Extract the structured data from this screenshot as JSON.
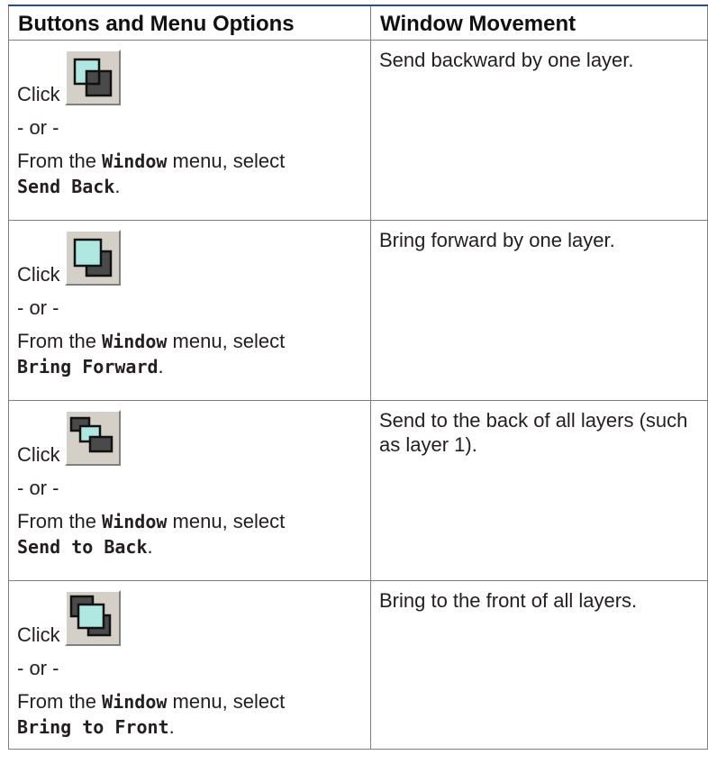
{
  "table": {
    "headers": [
      "Buttons and Menu Options",
      "Window Movement"
    ],
    "rows": [
      {
        "click_label": "Click",
        "icon": "send-back-icon",
        "or_label": "- or -",
        "menu_prefix": "From the",
        "menu_name": "Window",
        "menu_middle": "menu, select",
        "command": "Send Back",
        "period": ".",
        "description": "Send backward by one layer."
      },
      {
        "click_label": "Click",
        "icon": "bring-forward-icon",
        "or_label": "- or -",
        "menu_prefix": "From the",
        "menu_name": "Window",
        "menu_middle": "menu, select",
        "command": "Bring Forward",
        "period": ".",
        "description": "Bring forward by one layer."
      },
      {
        "click_label": "Click",
        "icon": "send-to-back-icon",
        "or_label": "- or -",
        "menu_prefix": "From the",
        "menu_name": "Window",
        "menu_middle": "menu, select",
        "command": "Send to Back",
        "period": ".",
        "description": "Send to the back of all layers (such as layer 1)."
      },
      {
        "click_label": "Click",
        "icon": "bring-to-front-icon",
        "or_label": "- or -",
        "menu_prefix": "From the",
        "menu_name": "Window",
        "menu_middle": "menu, select",
        "command": "Bring to Front",
        "period": ".",
        "description": "Bring to the front of all layers."
      }
    ]
  },
  "colors": {
    "header_rule": "#2a4e8a",
    "icon_front_fill": "#aee8e0",
    "icon_back_fill": "#4a4a4a",
    "button_face": "#d4d0c8"
  }
}
